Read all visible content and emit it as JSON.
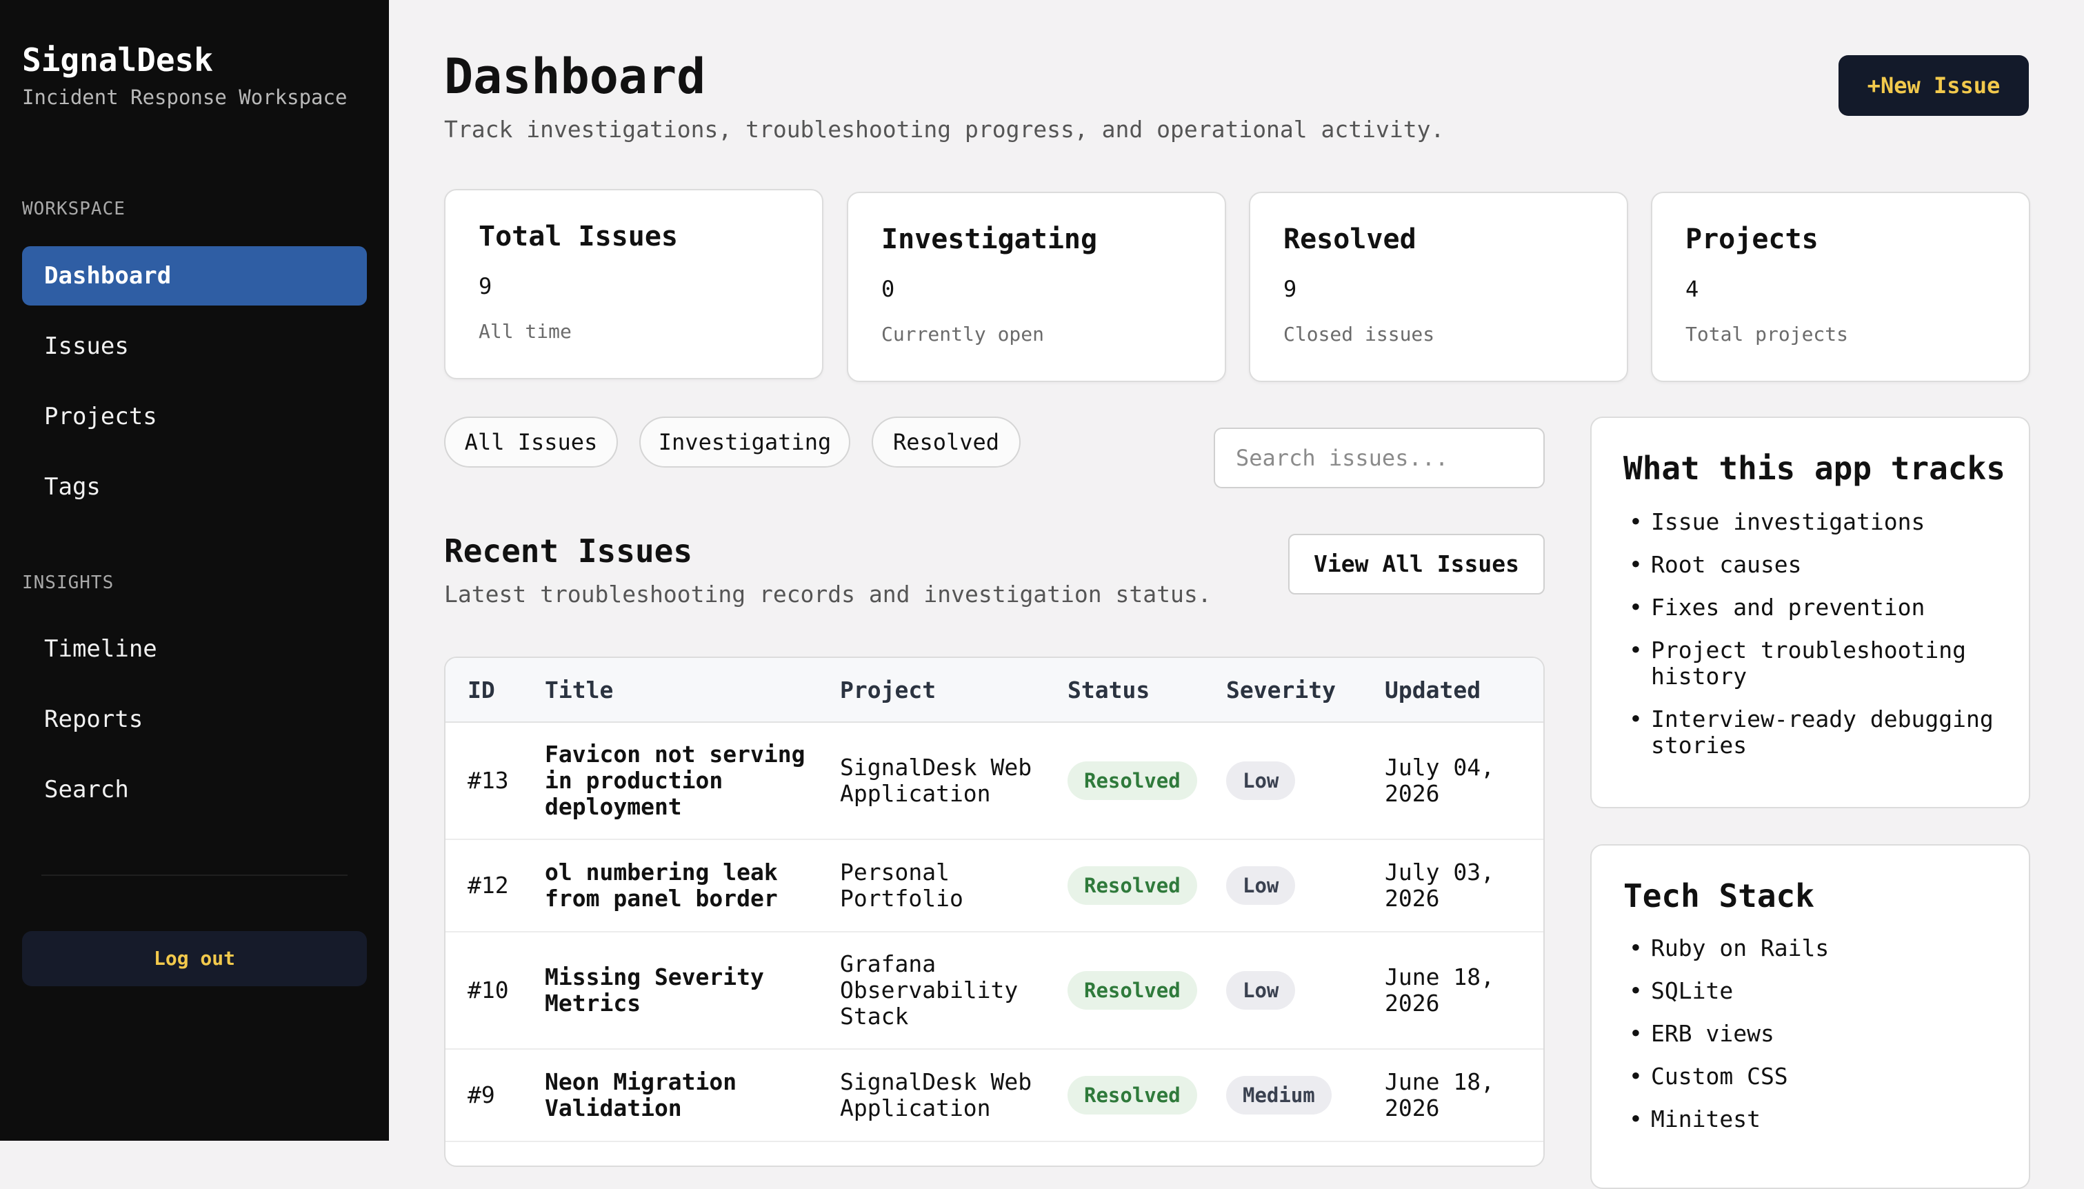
{
  "sidebar": {
    "brand": "SignalDesk",
    "brand_sub": "Incident Response Workspace",
    "sections": [
      {
        "label": "WORKSPACE",
        "items": [
          {
            "label": "Dashboard"
          },
          {
            "label": "Issues"
          },
          {
            "label": "Projects"
          },
          {
            "label": "Tags"
          }
        ]
      },
      {
        "label": "INSIGHTS",
        "items": [
          {
            "label": "Timeline"
          },
          {
            "label": "Reports"
          },
          {
            "label": "Search"
          }
        ]
      }
    ],
    "logout_label": "Log out"
  },
  "header": {
    "title": "Dashboard",
    "subtitle": "Track investigations, troubleshooting progress, and operational activity.",
    "new_issue_label": "+New Issue"
  },
  "stats": [
    {
      "title": "Total Issues",
      "value": "9",
      "note": "All time"
    },
    {
      "title": "Investigating",
      "value": "0",
      "note": "Currently open"
    },
    {
      "title": "Resolved",
      "value": "9",
      "note": "Closed issues"
    },
    {
      "title": "Projects",
      "value": "4",
      "note": "Total projects"
    }
  ],
  "filters": [
    "All Issues",
    "Investigating",
    "Resolved"
  ],
  "search": {
    "placeholder": "Search issues..."
  },
  "recent": {
    "title": "Recent Issues",
    "subtitle": "Latest troubleshooting records and investigation status.",
    "view_all_label": "View All Issues",
    "columns": [
      "ID",
      "Title",
      "Project",
      "Status",
      "Severity",
      "Updated"
    ],
    "rows": [
      {
        "id": "#13",
        "title": "Favicon not serving in production deployment",
        "project": "SignalDesk Web Application",
        "status": "Resolved",
        "severity": "Low",
        "updated": "July 04, 2026"
      },
      {
        "id": "#12",
        "title": "ol numbering leak from panel border",
        "project": "Personal Portfolio",
        "status": "Resolved",
        "severity": "Low",
        "updated": "July 03, 2026"
      },
      {
        "id": "#10",
        "title": "Missing Severity Metrics",
        "project": "Grafana Observability Stack",
        "status": "Resolved",
        "severity": "Low",
        "updated": "June 18, 2026"
      },
      {
        "id": "#9",
        "title": "Neon Migration Validation",
        "project": "SignalDesk Web Application",
        "status": "Resolved",
        "severity": "Medium",
        "updated": "June 18, 2026"
      }
    ]
  },
  "tracks": {
    "title": "What this app tracks",
    "items": [
      "Issue investigations",
      "Root causes",
      "Fixes and prevention",
      "Project troubleshooting history",
      "Interview-ready debugging stories"
    ]
  },
  "stack": {
    "title": "Tech Stack",
    "items": [
      "Ruby on Rails",
      "SQLite",
      "ERB views",
      "Custom CSS",
      "Minitest"
    ]
  },
  "colors": {
    "sidebar_bg": "#0d0d0d",
    "accent": "#2f5ea4",
    "button_dark": "#131a2a",
    "button_text": "#f2c94c",
    "resolved_bg": "#e8f3e8",
    "resolved_text": "#2f7a3b"
  }
}
